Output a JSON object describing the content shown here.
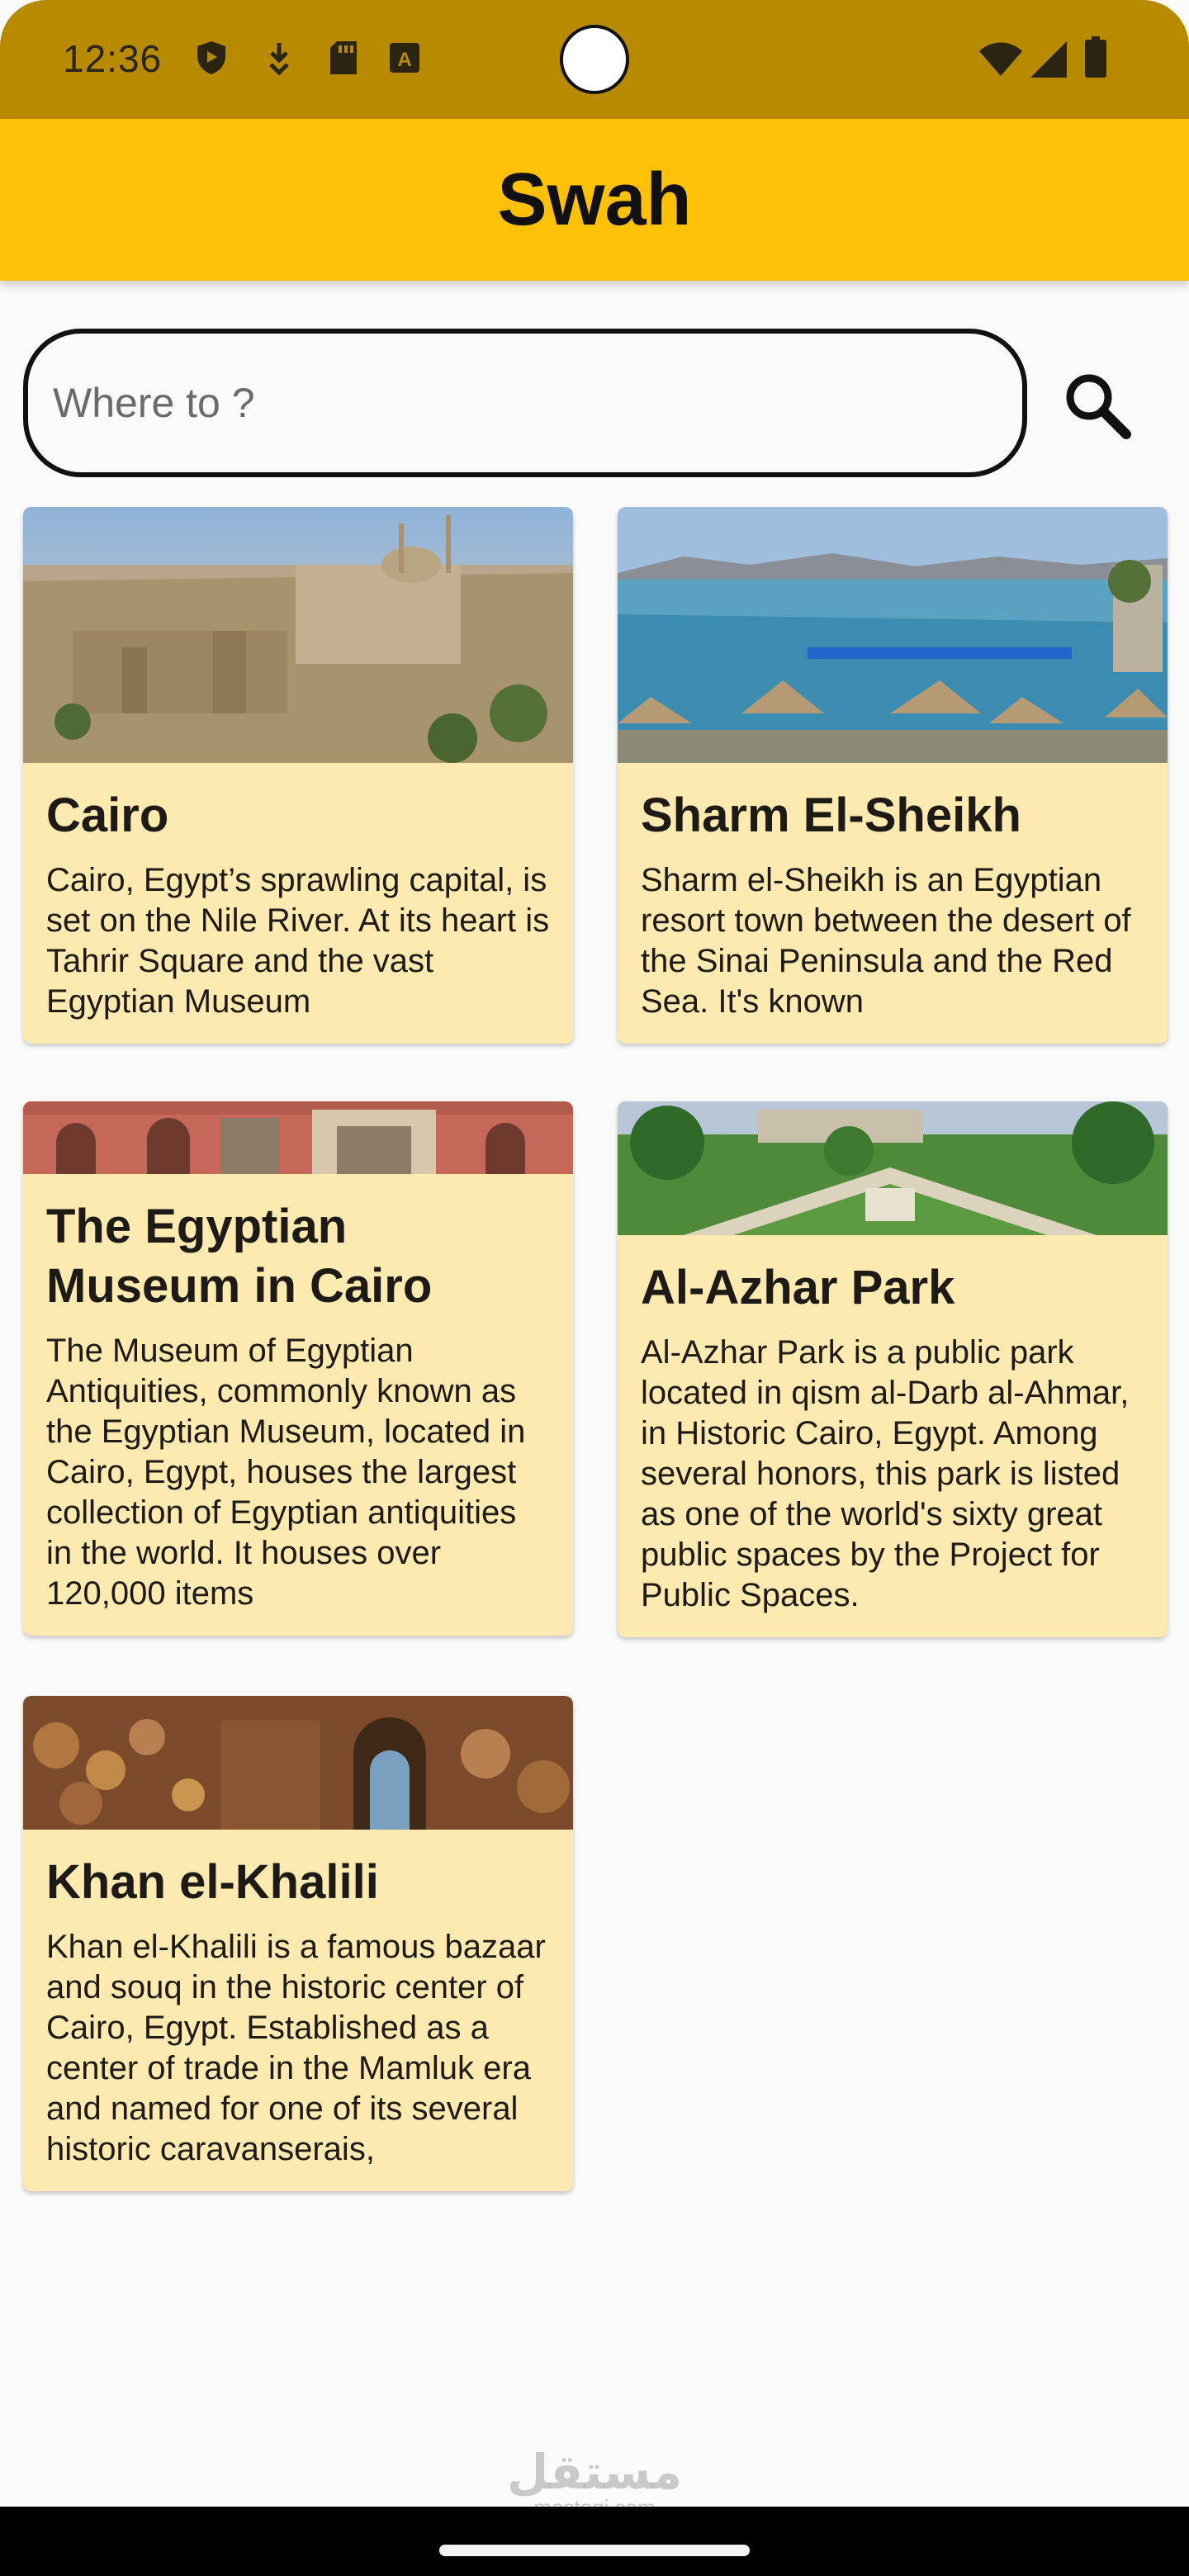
{
  "status_bar": {
    "time": "12:36",
    "icons": [
      "shield-icon",
      "download-icon",
      "sd-card-icon",
      "keyboard-a-icon",
      "wifi-icon",
      "signal-icon",
      "battery-icon"
    ]
  },
  "app_bar": {
    "title": "Swah"
  },
  "search": {
    "placeholder": "Where to ?",
    "value": "",
    "icon": "search-icon"
  },
  "places": [
    {
      "name": "Cairo",
      "description": "Cairo, Egypt’s sprawling capital, is set on the Nile River. At its heart is Tahrir Square and the vast Egyptian Museum"
    },
    {
      "name": "Sharm El-Sheikh",
      "description": "Sharm el-Sheikh is an Egyptian resort town between the desert of the Sinai Peninsula and the Red Sea. It's known"
    },
    {
      "name": "The Egyptian Museum in Cairo",
      "description": "The Museum of Egyptian Antiquities, commonly known as the Egyptian Museum, located in Cairo, Egypt, houses the largest collection of Egyptian antiquities in the world. It houses over 120,000 items"
    },
    {
      "name": "Al-Azhar Park",
      "description": "Al-Azhar Park is a public park located in qism al-Darb al-Ahmar, in Historic Cairo, Egypt. Among several honors, this park is listed as one of the world's sixty great public spaces by the Project for Public Spaces."
    },
    {
      "name": "Khan el-Khalili",
      "description": "Khan el-Khalili is a famous bazaar and souq in the historic center of Cairo, Egypt. Established as a center of trade in the Mamluk era and named for one of its several historic caravanserais,"
    }
  ],
  "watermark": {
    "arabic": "مستقل",
    "latin": "mostaqi.com"
  },
  "colors": {
    "app_bar": "#FFC107",
    "status_bar": "#B88A00",
    "card": "#FDEAB0",
    "background": "#FAFAFA"
  }
}
